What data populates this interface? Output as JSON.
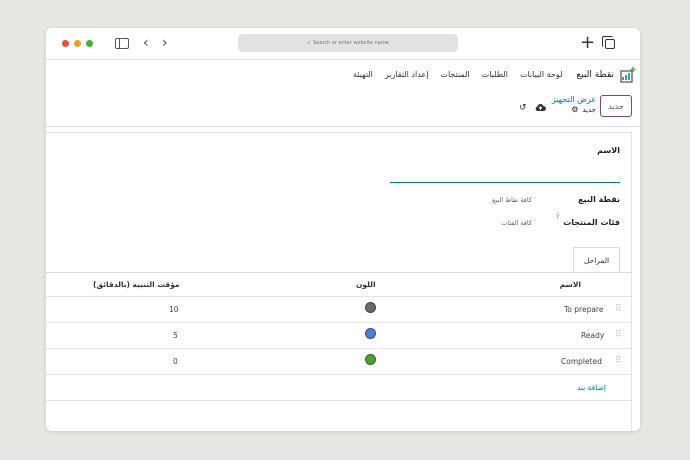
{
  "browser": {
    "url_placeholder": "Search or enter website name",
    "colors": {
      "close": "#e74c3c",
      "minimize": "#e0a422",
      "maximize": "#3db13d"
    }
  },
  "app": {
    "title": "نقطة البيع",
    "menu": [
      "لوحة البيانات",
      "الطلبات",
      "المنتجات",
      "إعداد التقارير",
      "التهيئة"
    ],
    "accent": "#017e84",
    "brand": "#7b4b6a"
  },
  "control_panel": {
    "new_label": "جديد",
    "breadcrumb": "عرض التجهيز",
    "record_state": "جديد"
  },
  "form": {
    "name_label": "الاسم",
    "name_value": "",
    "pos_label": "نقطة البيع",
    "pos_value": "كافة نقاط البيع",
    "categories_label": "فئات المنتجات",
    "categories_help": "?",
    "categories_value": "كافة الفئات",
    "tab_label": "المراحل"
  },
  "stages": {
    "columns": {
      "name": "الاسم",
      "color": "اللون",
      "timer": "مؤقت التنبيه (بالدقائق)"
    },
    "rows": [
      {
        "name": "To prepare",
        "color": "#6b6b6b",
        "timer": "10"
      },
      {
        "name": "Ready",
        "color": "#4c7fcf",
        "timer": "5"
      },
      {
        "name": "Completed",
        "color": "#4aa32e",
        "timer": "0"
      }
    ],
    "add_line": "إضافة بند"
  }
}
